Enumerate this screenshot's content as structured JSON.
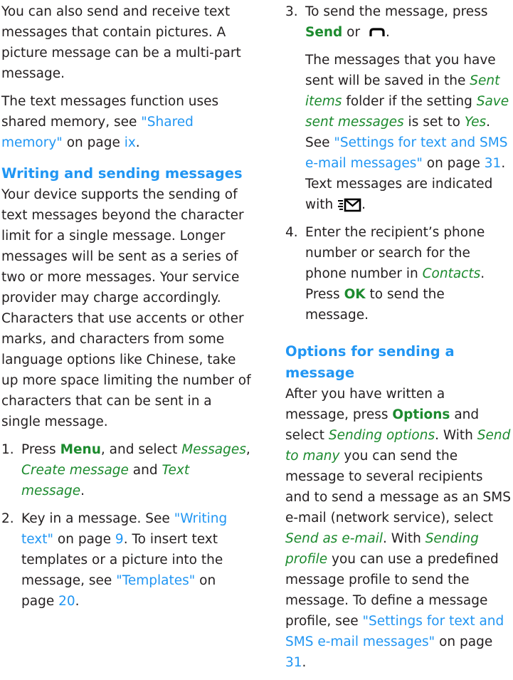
{
  "left": {
    "intro_p1": "You can also send and receive text messages that contain pictures. A picture message can be a multi-part message.",
    "intro_p2_pre": "The text messages function uses shared memory, see ",
    "intro_p2_link": "\"Shared memory\"",
    "intro_p2_mid": " on page ",
    "intro_p2_page": "ix",
    "intro_p2_post": ".",
    "heading": "Writing and sending messages",
    "body": "Your device supports the sending of text messages beyond the character limit for a single message. Longer messages will be sent as a series of two or more messages. Your service provider may charge accordingly. Characters that use accents or other marks, and characters from some language options like Chinese, take up more space limiting the number of characters that can be sent in a single message.",
    "step1": {
      "num": "1.",
      "t1": "Press ",
      "menu": "Menu",
      "t2": ", and select ",
      "messages": "Messages",
      "t3": ", ",
      "create": "Create message",
      "t4": " and ",
      "textmsg": "Text message",
      "t5": "."
    },
    "step2": {
      "num": "2.",
      "t1": "Key in a message. See ",
      "link1": "\"Writing text\"",
      "t2": " on page ",
      "page1": "9",
      "t3": ". To insert text templates or a picture into the message, see ",
      "link2": "\"Templates\"",
      "t4": " on page ",
      "page2": "20",
      "t5": "."
    }
  },
  "right": {
    "step3": {
      "num": "3.",
      "t1": "To send the message, press ",
      "send": "Send",
      "t2": " or ",
      "t3": ".",
      "p2_1": "The messages that you have sent will be saved in the ",
      "sent_items": "Sent items",
      "p2_2": " folder if the setting ",
      "save_sent": "Save sent messages",
      "p2_3": " is set to ",
      "yes": "Yes",
      "p2_4": ". See ",
      "settings_link": "\"Settings for text and SMS e-mail messages\"",
      "p2_5": " on page ",
      "page": "31",
      "p2_6": ". Text messages are indicated with ",
      "p2_7": "."
    },
    "step4": {
      "num": "4.",
      "t1": "Enter the recipient’s phone number or search for the phone number in ",
      "contacts": "Contacts",
      "t2": ". Press ",
      "ok": "OK",
      "t3": " to send the message."
    },
    "heading": "Options for sending a message",
    "opts": {
      "t1": "After you have written a message, press ",
      "options": "Options",
      "t2": " and select ",
      "sending_options": "Sending options",
      "t3": ". With ",
      "send_to_many": "Send to many",
      "t4": " you can send the message to several recipients and to send a message as an SMS e-mail (network service), select ",
      "send_as_email": "Send as e-mail",
      "t5": ". With ",
      "sending_profile": "Sending profile",
      "t6": " you can use a predefined message profile to send the message. To define a message profile, see ",
      "settings_link": "\"Settings for text and SMS e-mail messages\"",
      "t7": " on page ",
      "page": "31",
      "t8": "."
    }
  },
  "colors": {
    "text": "#231f20",
    "link": "#2196f3",
    "keyword": "#1c8a2e"
  },
  "icons": [
    "end-key-icon",
    "text-message-icon"
  ]
}
